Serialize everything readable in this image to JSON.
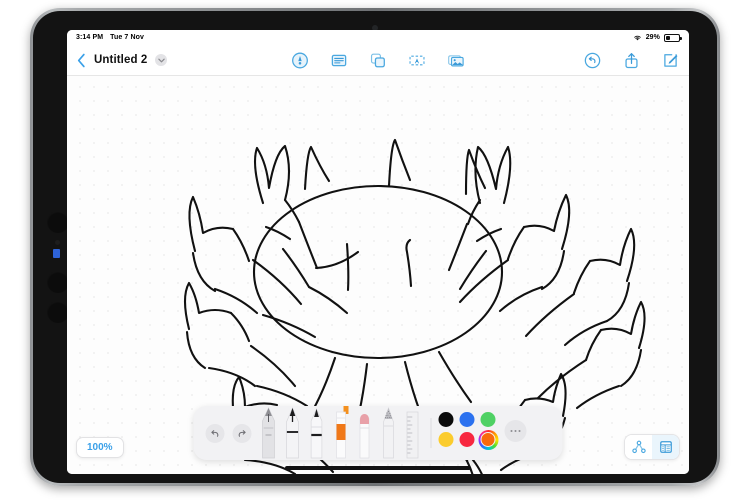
{
  "status_bar": {
    "time": "3:14 PM",
    "date": "Tue 7 Nov",
    "battery_percent": "29%",
    "battery_level": 29,
    "wifi_icon": "wifi-icon",
    "battery_icon": "battery-icon"
  },
  "navbar": {
    "back_icon": "back-chevron-icon",
    "document_title": "Untitled 2",
    "title_chevron_icon": "chevron-down-icon",
    "center_tools": [
      {
        "name": "annotate-pen-tool",
        "icon": "pen-circle-icon"
      },
      {
        "name": "text-note-tool",
        "icon": "document-lines-icon"
      },
      {
        "name": "shapes-tool",
        "icon": "overlapping-squares-icon"
      },
      {
        "name": "text-box-tool",
        "icon": "text-box-icon"
      },
      {
        "name": "insert-image-tool",
        "icon": "photo-icon"
      }
    ],
    "right_tools": [
      {
        "name": "undo-history",
        "icon": "undo-circle-icon"
      },
      {
        "name": "share",
        "icon": "share-upload-icon"
      },
      {
        "name": "compose",
        "icon": "compose-pencil-icon"
      }
    ]
  },
  "canvas": {
    "background": "dot-grid",
    "dot_color": "#d8d8d8",
    "drawing_subject": "hand-drawn crab sketch",
    "stroke_color": "#111111"
  },
  "zoom_badge": {
    "label": "100%",
    "accent_color": "#3aa0e8"
  },
  "view_toggle": {
    "buttons": [
      {
        "name": "outline-view",
        "icon": "node-graph-icon",
        "active": false
      },
      {
        "name": "page-grid-view",
        "icon": "page-grid-icon",
        "active": true
      }
    ]
  },
  "palette": {
    "history": [
      {
        "name": "undo-button",
        "icon": "undo-arrow-icon"
      },
      {
        "name": "redo-button",
        "icon": "redo-arrow-icon"
      }
    ],
    "tools": [
      {
        "name": "fountain-pen-tool",
        "label": "Fountain Pen",
        "color": "#d9d9dc",
        "selected": false
      },
      {
        "name": "ballpoint-pen-tool",
        "label": "Pen",
        "color": "#f2f2f4",
        "selected": false
      },
      {
        "name": "marker-pen-tool",
        "label": "Marker",
        "color": "#f6f6f8",
        "selected": false
      },
      {
        "name": "highlighter-tool",
        "label": "Highlighter",
        "color": "#f07818",
        "selected": true
      },
      {
        "name": "eraser-tool",
        "label": "Eraser",
        "color": "#e8a0a8",
        "selected": false
      },
      {
        "name": "pencil-tool",
        "label": "Pencil",
        "color": "#e0e0e3",
        "selected": false
      },
      {
        "name": "ruler-tool",
        "label": "Ruler",
        "color": "#ededf0",
        "selected": false
      }
    ],
    "colors": [
      {
        "name": "color-black",
        "hex": "#0b0b0b",
        "selected": false
      },
      {
        "name": "color-blue",
        "hex": "#2b71ef",
        "selected": false
      },
      {
        "name": "color-green",
        "hex": "#4fd164",
        "selected": false
      },
      {
        "name": "color-yellow",
        "hex": "#fbcc2d",
        "selected": false
      },
      {
        "name": "color-red",
        "hex": "#f7273f",
        "selected": false
      },
      {
        "name": "color-orange",
        "hex": "#f96a0d",
        "selected": true
      }
    ],
    "more_button": {
      "name": "more-colors-button",
      "icon": "ellipsis-icon"
    }
  }
}
